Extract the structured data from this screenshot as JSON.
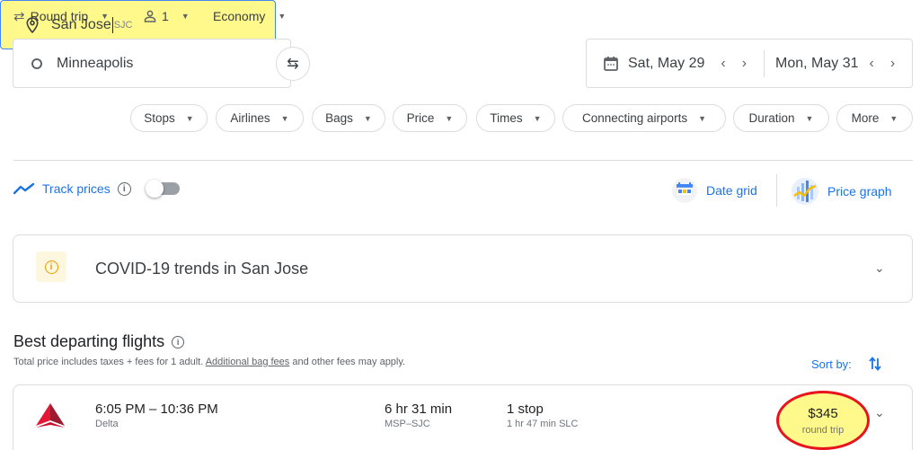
{
  "options": {
    "trip_type": "Round trip",
    "passengers": "1",
    "cabin": "Economy"
  },
  "search": {
    "origin": "Minneapolis",
    "destination": "San Jose",
    "destination_code": "SJC",
    "depart_date": "Sat, May 29",
    "return_date": "Mon, May 31"
  },
  "filters": [
    "Stops",
    "Airlines",
    "Bags",
    "Price",
    "Times",
    "Connecting airports",
    "Duration",
    "More"
  ],
  "track": {
    "label": "Track prices",
    "enabled": false
  },
  "views": {
    "date_grid": "Date grid",
    "price_graph": "Price graph"
  },
  "covid": {
    "title": "COVID-19 trends in San Jose"
  },
  "results": {
    "title": "Best departing flights",
    "subtitle_pre": "Total price includes taxes + fees for 1 adult. ",
    "subtitle_link": "Additional bag fees",
    "subtitle_post": " and other fees may apply.",
    "sort_label": "Sort by:",
    "flights": [
      {
        "times": "6:05 PM – 10:36 PM",
        "airline": "Delta",
        "duration": "6 hr 31 min",
        "route": "MSP–SJC",
        "stops": "1 stop",
        "layover": "1 hr 47 min SLC",
        "price": "$345",
        "price_type": "round trip"
      }
    ]
  },
  "colors": {
    "accent": "#1a73e8",
    "highlight": "#fff98c",
    "annotation": "#e8141d",
    "delta_red": "#c8102e"
  }
}
